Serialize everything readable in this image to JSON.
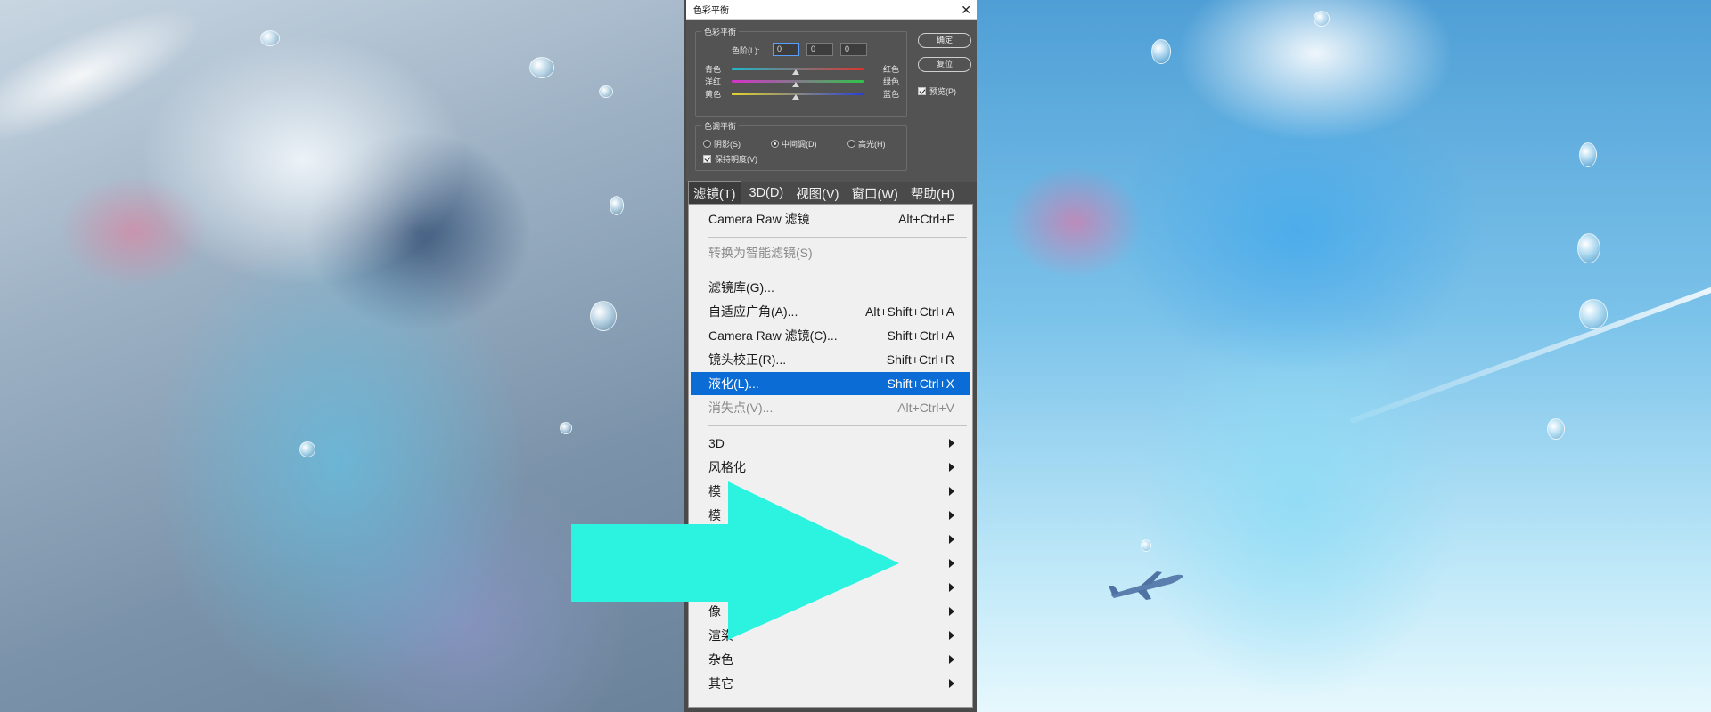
{
  "dialog": {
    "title": "色彩平衡",
    "close_glyph": "✕",
    "color_balance_group": "色彩平衡",
    "levels_label": "色阶(L):",
    "levels_values": [
      "0",
      "0",
      "0"
    ],
    "sliders": [
      {
        "left": "青色",
        "right": "红色",
        "gradient": [
          "#1fb8c9",
          "#d9362f"
        ]
      },
      {
        "left": "洋红",
        "right": "绿色",
        "gradient": [
          "#d432c9",
          "#31c24a"
        ]
      },
      {
        "left": "黄色",
        "right": "蓝色",
        "gradient": [
          "#e6d42a",
          "#2a3fd6"
        ]
      }
    ],
    "tone_group": "色调平衡",
    "tones": {
      "shadows": "阴影(S)",
      "midtones": "中间调(D)",
      "highlights": "高光(H)"
    },
    "preserve_luminosity": "保持明度(V)",
    "ok": "确定",
    "reset": "复位",
    "preview": "预览(P)"
  },
  "menubar": {
    "items": [
      "滤镜(T)",
      "3D(D)",
      "视图(V)",
      "窗口(W)",
      "帮助(H)"
    ]
  },
  "menu": {
    "camera_raw_top": {
      "label": "Camera Raw 滤镜",
      "shortcut": "Alt+Ctrl+F"
    },
    "convert_smart": {
      "label": "转换为智能滤镜(S)"
    },
    "filter_gallery": {
      "label": "滤镜库(G)..."
    },
    "adaptive_wide": {
      "label": "自适应广角(A)...",
      "shortcut": "Alt+Shift+Ctrl+A"
    },
    "camera_raw": {
      "label": "Camera Raw 滤镜(C)...",
      "shortcut": "Shift+Ctrl+A"
    },
    "lens_correction": {
      "label": "镜头校正(R)...",
      "shortcut": "Shift+Ctrl+R"
    },
    "liquify": {
      "label": "液化(L)...",
      "shortcut": "Shift+Ctrl+X"
    },
    "vanishing_point": {
      "label": "消失点(V)...",
      "shortcut": "Alt+Ctrl+V"
    },
    "submenus": [
      "3D",
      "风格化",
      "模",
      "模",
      "",
      "",
      "",
      "像",
      "渲染",
      "杂色",
      "其它"
    ]
  },
  "colors": {
    "highlight": "#0a6cd4",
    "arrow": "#2cf2e0"
  }
}
